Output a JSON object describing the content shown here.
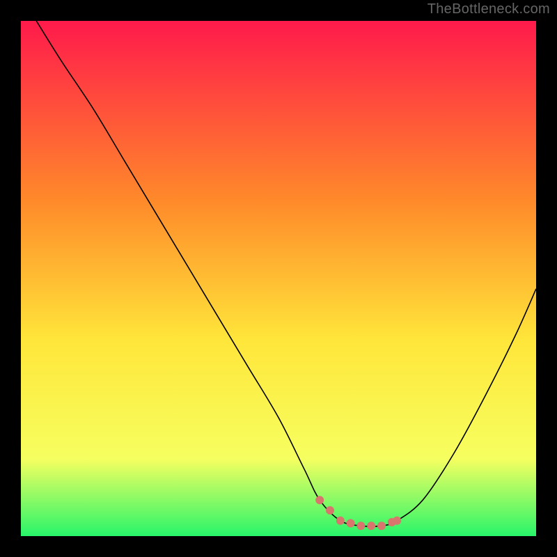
{
  "watermark": "TheBottleneck.com",
  "chart_data": {
    "type": "line",
    "title": "",
    "xlabel": "",
    "ylabel": "",
    "xlim": [
      0,
      100
    ],
    "ylim": [
      0,
      100
    ],
    "grid": false,
    "series": [
      {
        "name": "bottleneck-curve",
        "x": [
          3,
          8,
          14,
          20,
          26,
          32,
          38,
          44,
          50,
          55,
          58,
          62,
          66,
          70,
          73,
          78,
          84,
          90,
          96,
          100
        ],
        "values": [
          100,
          92,
          83,
          73,
          63,
          53,
          43,
          33,
          23,
          13,
          7,
          3,
          2,
          2,
          3,
          7,
          16,
          27,
          39,
          48
        ],
        "color": "#000000",
        "width": 1.6
      },
      {
        "name": "sweet-spot-dots",
        "x": [
          58,
          60,
          62,
          64,
          66,
          68,
          70,
          72,
          73
        ],
        "values": [
          7,
          5,
          3,
          2.5,
          2,
          2,
          2,
          2.7,
          3
        ],
        "color": "#d8766d",
        "marker_radius": 6
      }
    ],
    "background_gradient": {
      "top": "#ff1a4b",
      "mid1": "#ff8a2a",
      "mid2": "#ffe63a",
      "mid3": "#f6ff60",
      "bottom": "#28f56a"
    }
  }
}
